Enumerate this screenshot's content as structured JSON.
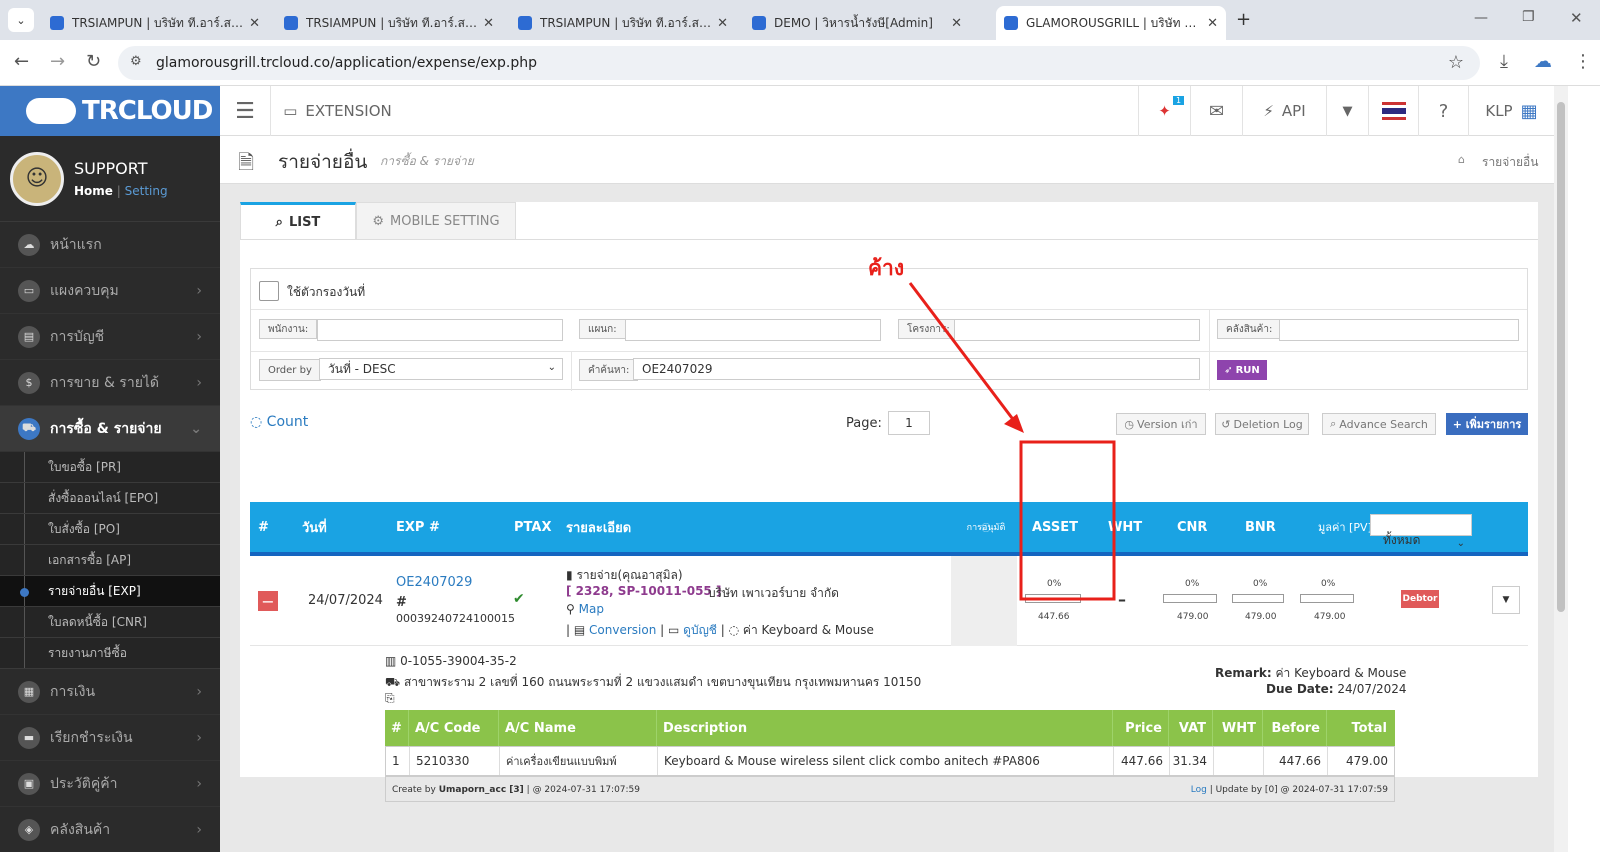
{
  "browser": {
    "tabs": [
      {
        "label": "TRSIAMPUN | บริษัท ที.อาร์.สยามภั"
      },
      {
        "label": "TRSIAMPUN | บริษัท ที.อาร์.สยามภั"
      },
      {
        "label": "TRSIAMPUN | บริษัท ที.อาร์.สยามภั"
      },
      {
        "label": "DEMO | วิหารน้ำรังษี[Admin]"
      },
      {
        "label": "GLAMOROUSGRILL | บริษัท แกลม"
      }
    ],
    "url": "glamorousgrill.trcloud.co/application/expense/exp.php"
  },
  "sidebar": {
    "logo": "TRCLOUD",
    "user_name": "SUPPORT",
    "home_link": "Home",
    "setting_link": "Setting",
    "items": [
      {
        "label": "หน้าแรก"
      },
      {
        "label": "แผงควบคุม"
      },
      {
        "label": "การบัญชี"
      },
      {
        "label": "การขาย & รายได้"
      },
      {
        "label": "การซื้อ & รายจ่าย"
      },
      {
        "label": "การเงิน"
      },
      {
        "label": "เรียกชำระเงิน"
      },
      {
        "label": "ประวัติคู่ค้า"
      },
      {
        "label": "คลังสินค้า"
      }
    ],
    "subitems": [
      {
        "label": "ใบขอซื้อ [PR]"
      },
      {
        "label": "สั่งซื้อออนไลน์ [EPO]"
      },
      {
        "label": "ใบสั่งซื้อ [PO]"
      },
      {
        "label": "เอกสารซื้อ [AP]"
      },
      {
        "label": "รายจ่ายอื่น [EXP]"
      },
      {
        "label": "ใบลดหนี้ซื้อ [CNR]"
      },
      {
        "label": "รายงานภาษีซื้อ"
      }
    ]
  },
  "appbar": {
    "extension": "EXTENSION",
    "notif_count": "1",
    "api": "API",
    "user": "KLP"
  },
  "page": {
    "title": "รายจ่ายอื่น",
    "subtitle": "การซื้อ & รายจ่าย",
    "breadcrumb": "รายจ่ายอื่น"
  },
  "tabs": {
    "list": "LIST",
    "mobile": "MOBILE SETTING"
  },
  "filter": {
    "date_filter_label": "ใช้ตัวกรองวันที่",
    "employee_label": "พนักงาน:",
    "dept_label": "แผนก:",
    "project_label": "โครงการ:",
    "warehouse_label": "คลังสินค้า:",
    "order_label": "Order by",
    "order_value": "วันที่ - DESC",
    "search_label": "คำค้นหา:",
    "search_value": "OE2407029",
    "run": "RUN"
  },
  "toolbar": {
    "count": "Count",
    "page_label": "Page:",
    "page_value": "1",
    "version": "Version เก่า",
    "deletion": "Deletion Log",
    "advance": "Advance Search",
    "add": "+ เพิ่มรายการ"
  },
  "annotation": {
    "text": "ค้าง"
  },
  "table": {
    "headers": {
      "num": "#",
      "date": "วันที่",
      "exp": "EXP #",
      "ptax": "PTAX",
      "detail": "รายละเอียด",
      "approve": "การอนุมัติ",
      "asset": "ASSET",
      "wht": "WHT",
      "cnr": "CNR",
      "bnr": "BNR",
      "pv": "มูลค่า [PV]",
      "filter": "ทั้งหมด"
    },
    "row": {
      "date": "24/07/2024",
      "exp_no": "OE2407029",
      "hash": "#",
      "ref_no": "00039240724100015",
      "detail_type": "รายจ่าย(คุณอาสุมิล)",
      "supplier_code": "[ 2328, SP-10011-055 ]",
      "supplier_name": "บริษัท เพาเวอร์บาย จำกัด",
      "map": "Map",
      "conversion": "Conversion",
      "view_acc": "ดูบัญชี",
      "note": "ค่า Keyboard & Mouse",
      "asset_pct": "0%",
      "asset_val": "447.66",
      "asset_fraction": 0,
      "wht": "–",
      "cnr_pct": "0%",
      "cnr_val": "479.00",
      "bnr_pct": "0%",
      "bnr_val": "479.00",
      "pv_pct": "0%",
      "pv_val": "479.00",
      "status": "Debtor"
    }
  },
  "detail": {
    "tax_id": "0-1055-39004-35-2",
    "address": "สาขาพระราม 2 เลขที่ 160 ถนนพระรามที่ 2 แขวงแสมดำ เขตบางขุนเทียน กรุงเทพมหานคร 10150",
    "remark_label": "Remark:",
    "remark": "ค่า Keyboard & Mouse",
    "due_label": "Due Date:",
    "due": "24/07/2024",
    "items_headers": [
      "#",
      "A/C Code",
      "A/C Name",
      "Description",
      "Price",
      "VAT",
      "WHT",
      "Before",
      "Total"
    ],
    "items": [
      [
        "1",
        "5210330",
        "ค่าเครื่องเขียนแบบพิมพ์",
        "Keyboard & Mouse wireless silent click combo anitech #PA806",
        "447.66",
        "31.34",
        "",
        "447.66",
        "479.00"
      ]
    ],
    "created_prefix": "Create by",
    "created_user": "Umaporn_acc [3]",
    "created_time": "| @ 2024-07-31 17:07:59",
    "log": "Log",
    "updated": "| Update by [0] @ 2024-07-31 17:07:59"
  },
  "colors": {
    "accent": "#1aa3e3",
    "sidebar": "#2b2b2b",
    "logo_bg": "#3d78c4",
    "green": "#8bc34a",
    "annotation": "#e8201a",
    "run": "#8e44ad",
    "add": "#3a6dbf"
  }
}
